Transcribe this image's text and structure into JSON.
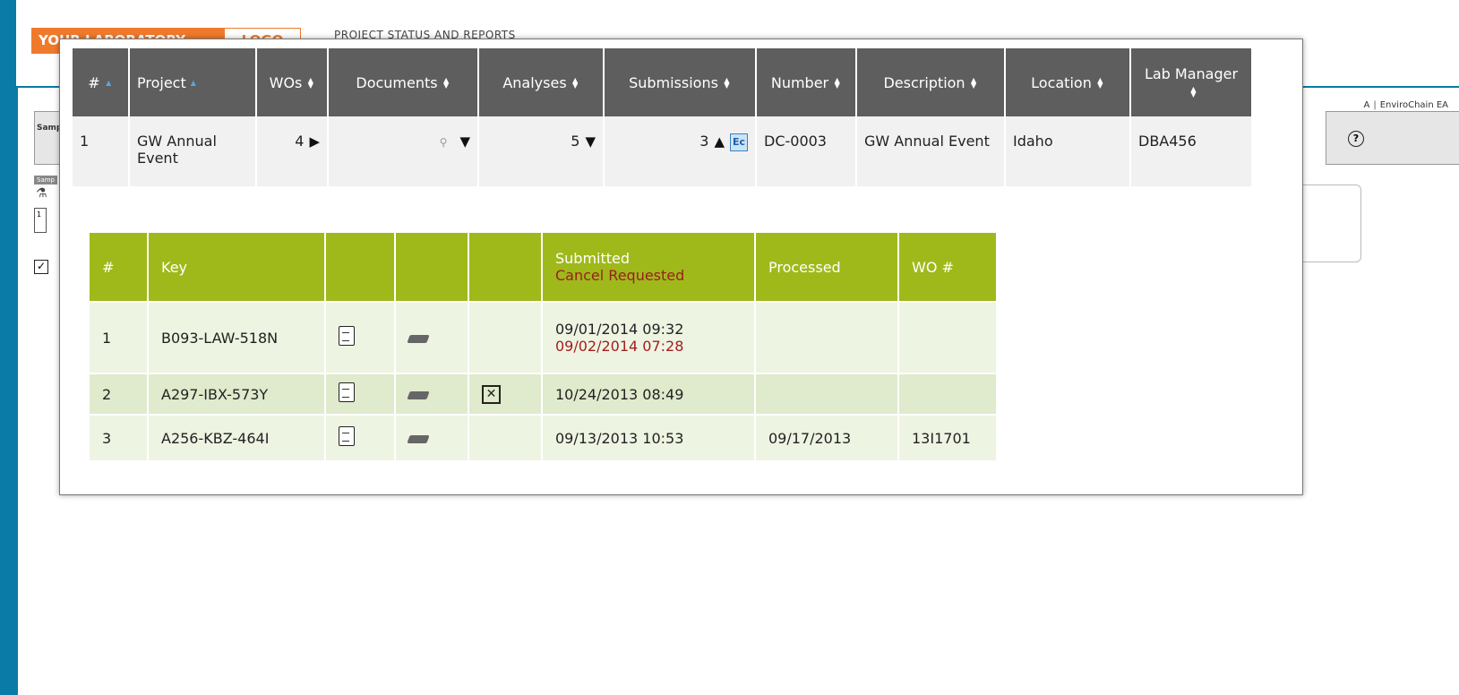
{
  "header": {
    "logo_left": "YOUR LABORATORY",
    "logo_right": "LOGO",
    "app_title": "PROJECT STATUS AND REPORTS"
  },
  "nav": {
    "prefix": "A",
    "item": "EnviroChain EA"
  },
  "background": {
    "side_label": "Sampl",
    "samp_tab": "Samp",
    "samp_box": "1"
  },
  "projects": {
    "columns": [
      "#",
      "Project",
      "WOs",
      "Documents",
      "Analyses",
      "Submissions",
      "Number",
      "Description",
      "Location",
      "Lab Manager"
    ],
    "row": {
      "num": "1",
      "project": "GW Annual Event",
      "wos": "4",
      "analyses": "5",
      "submissions": "3",
      "ec_badge": "Ec",
      "number": "DC-0003",
      "description": "GW Annual Event",
      "location": "Idaho",
      "lab_manager": "DBA456"
    }
  },
  "submissions": {
    "columns": {
      "num": "#",
      "key": "Key",
      "submitted": "Submitted",
      "cancel_requested": "Cancel Requested",
      "processed": "Processed",
      "wo": "WO #"
    },
    "rows": [
      {
        "num": "1",
        "key": "B093-LAW-518N",
        "submitted": "09/01/2014 09:32",
        "cancel": "09/02/2014 07:28",
        "processed": "",
        "wo": ""
      },
      {
        "num": "2",
        "key": "A297-IBX-573Y",
        "submitted": "10/24/2013 08:49",
        "cancel": "",
        "processed": "",
        "wo": ""
      },
      {
        "num": "3",
        "key": "A256-KBZ-464I",
        "submitted": "09/13/2013 10:53",
        "cancel": "",
        "processed": "09/17/2013",
        "wo": "13I1701"
      }
    ]
  }
}
